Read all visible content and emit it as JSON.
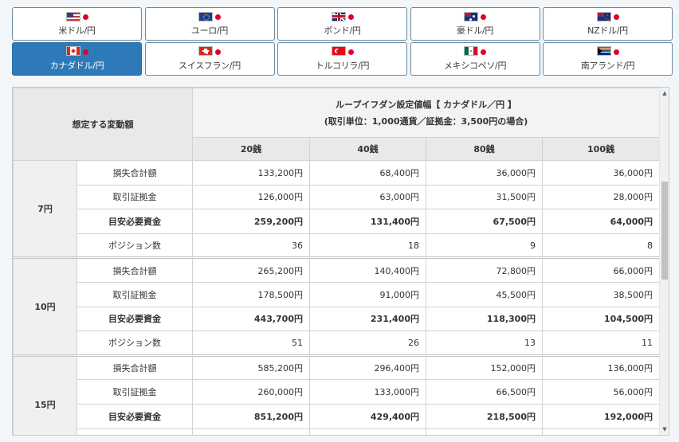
{
  "tabs": [
    {
      "label": "米ドル/円",
      "flag": "us-flag-icon",
      "active": false
    },
    {
      "label": "ユーロ/円",
      "flag": "eu-flag-icon",
      "active": false
    },
    {
      "label": "ポンド/円",
      "flag": "gb-flag-icon",
      "active": false
    },
    {
      "label": "豪ドル/円",
      "flag": "au-flag-icon",
      "active": false
    },
    {
      "label": "NZドル/円",
      "flag": "nz-flag-icon",
      "active": false
    },
    {
      "label": "カナダドル/円",
      "flag": "ca-flag-icon",
      "active": true
    },
    {
      "label": "スイスフラン/円",
      "flag": "ch-flag-icon",
      "active": false
    },
    {
      "label": "トルコリラ/円",
      "flag": "tr-flag-icon",
      "active": false
    },
    {
      "label": "メキシコペソ/円",
      "flag": "mx-flag-icon",
      "active": false
    },
    {
      "label": "南アランド/円",
      "flag": "za-flag-icon",
      "active": false
    }
  ],
  "colors": {
    "active_tab": "#2e7ab8",
    "jp_dot": "#e0002a"
  },
  "table": {
    "corner_header": "想定する変動額",
    "title_line1": "ループイフダン設定値幅【 カナダドル／円 】",
    "title_line2": "(取引単位：1,000通貨／証拠金：3,500円の場合)",
    "columns": [
      "20銭",
      "40銭",
      "80銭",
      "100銭"
    ],
    "groups": [
      {
        "label": "7円",
        "rows": [
          {
            "item": "損失合計額",
            "bold": false,
            "values": [
              "133,200円",
              "68,400円",
              "36,000円",
              "36,000円"
            ]
          },
          {
            "item": "取引証拠金",
            "bold": false,
            "values": [
              "126,000円",
              "63,000円",
              "31,500円",
              "28,000円"
            ]
          },
          {
            "item": "目安必要資金",
            "bold": true,
            "values": [
              "259,200円",
              "131,400円",
              "67,500円",
              "64,000円"
            ]
          },
          {
            "item": "ポジション数",
            "bold": false,
            "values": [
              "36",
              "18",
              "9",
              "8"
            ]
          }
        ]
      },
      {
        "label": "10円",
        "rows": [
          {
            "item": "損失合計額",
            "bold": false,
            "values": [
              "265,200円",
              "140,400円",
              "72,800円",
              "66,000円"
            ]
          },
          {
            "item": "取引証拠金",
            "bold": false,
            "values": [
              "178,500円",
              "91,000円",
              "45,500円",
              "38,500円"
            ]
          },
          {
            "item": "目安必要資金",
            "bold": true,
            "values": [
              "443,700円",
              "231,400円",
              "118,300円",
              "104,500円"
            ]
          },
          {
            "item": "ポジション数",
            "bold": false,
            "values": [
              "51",
              "26",
              "13",
              "11"
            ]
          }
        ]
      },
      {
        "label": "15円",
        "rows": [
          {
            "item": "損失合計額",
            "bold": false,
            "values": [
              "585,200円",
              "296,400円",
              "152,000円",
              "136,000円"
            ]
          },
          {
            "item": "取引証拠金",
            "bold": false,
            "values": [
              "260,000円",
              "133,000円",
              "66,500円",
              "56,000円"
            ]
          },
          {
            "item": "目安必要資金",
            "bold": true,
            "values": [
              "851,200円",
              "429,400円",
              "218,500円",
              "192,000円"
            ]
          },
          {
            "item": "ポジション数",
            "bold": false,
            "values": [
              "",
              "",
              "",
              ""
            ]
          }
        ]
      }
    ]
  },
  "scrollbar": {
    "up_icon": "▲",
    "down_icon": "▼"
  }
}
